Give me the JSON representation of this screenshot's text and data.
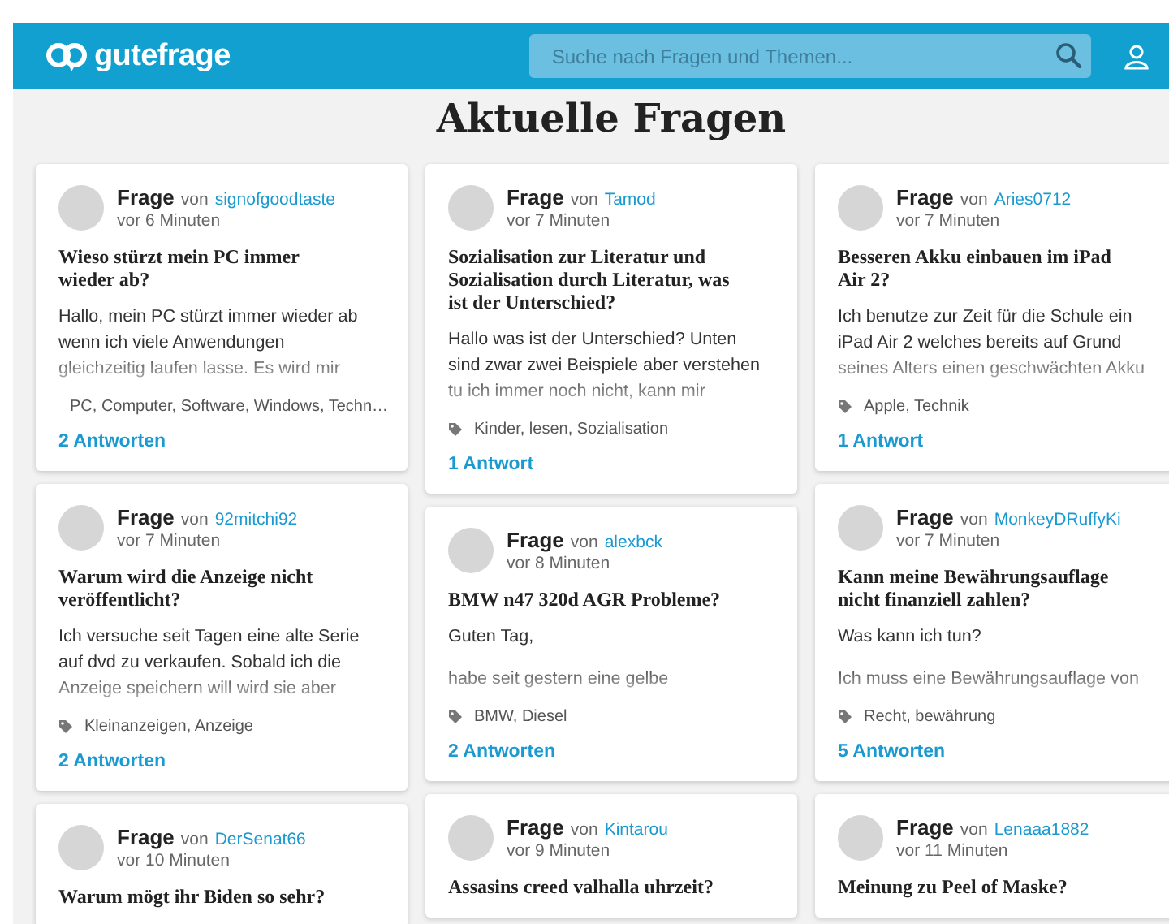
{
  "header": {
    "logo": "gutefrage",
    "search": {
      "placeholder": "Suche nach Fragen und Themen..."
    }
  },
  "heading": "Aktuelle Fragen",
  "columns": [
    {
      "questions": [
        {
          "label": "Frage",
          "by": "von",
          "author": "signofgoodtaste",
          "time": "vor 6 Minuten",
          "title": "Wieso stürzt mein PC immer\nwieder ab?",
          "preview": [
            "Hallo, mein PC stürzt immer wieder ab\nwenn ich viele Anwendungen\ngleichzeitig laufen lasse. Es wird mir"
          ],
          "tags": "PC, Computer, Software, Windows, Techn…",
          "answers": "2 Antworten"
        },
        {
          "label": "Frage",
          "by": "von",
          "author": "92mitchi92",
          "time": "vor 7 Minuten",
          "title": "Warum wird die Anzeige nicht\nveröffentlicht?",
          "preview": [
            "Ich versuche seit Tagen eine alte Serie\nauf dvd zu verkaufen. Sobald ich die\nAnzeige speichern will wird sie aber"
          ],
          "tags": "Kleinanzeigen, Anzeige",
          "answers": "2 Antworten"
        },
        {
          "label": "Frage",
          "by": "von",
          "author": "DerSenat66",
          "time": "vor 10 Minuten",
          "title": "Warum mögt ihr Biden so sehr?"
        }
      ]
    },
    {
      "questions": [
        {
          "label": "Frage",
          "by": "von",
          "author": "Tamod",
          "time": "vor 7 Minuten",
          "title": "Sozialisation zur Literatur und\nSozialisation durch Literatur, was\nist der Unterschied?",
          "preview": [
            "Hallo was ist der Unterschied? Unten\nsind zwar zwei Beispiele aber verstehen\ntu ich immer noch nicht, kann mir"
          ],
          "tags": "Kinder, lesen, Sozialisation",
          "answers": "1 Antwort"
        },
        {
          "label": "Frage",
          "by": "von",
          "author": "alexbck",
          "time": "vor 8 Minuten",
          "title": "BMW n47 320d AGR Probleme?",
          "preview": [
            "Guten Tag,",
            "habe seit gestern eine gelbe"
          ],
          "tags": "BMW, Diesel",
          "answers": "2 Antworten"
        },
        {
          "label": "Frage",
          "by": "von",
          "author": "Kintarou",
          "time": "vor 9 Minuten",
          "title": "Assasins creed valhalla uhrzeit?"
        }
      ]
    },
    {
      "questions": [
        {
          "label": "Frage",
          "by": "von",
          "author": "Aries0712",
          "time": "vor 7 Minuten",
          "title": "Besseren Akku einbauen im iPad\nAir 2?",
          "preview": [
            "Ich benutze zur Zeit für die Schule ein\niPad Air 2 welches bereits auf Grund\nseines Alters einen geschwächten Akku"
          ],
          "tags": "Apple, Technik",
          "answers": "1 Antwort"
        },
        {
          "label": "Frage",
          "by": "von",
          "author": "MonkeyDRuffyKi",
          "time": "vor 7 Minuten",
          "title": "Kann meine Bewährungsauflage\nnicht finanziell zahlen?",
          "preview": [
            "Was kann ich tun?",
            "Ich muss eine Bewährungsauflage von"
          ],
          "tags": "Recht, bewährung",
          "answers": "5 Antworten"
        },
        {
          "label": "Frage",
          "by": "von",
          "author": "Lenaaa1882",
          "time": "vor 11 Minuten",
          "title": "Meinung zu Peel of Maske?"
        }
      ]
    }
  ]
}
